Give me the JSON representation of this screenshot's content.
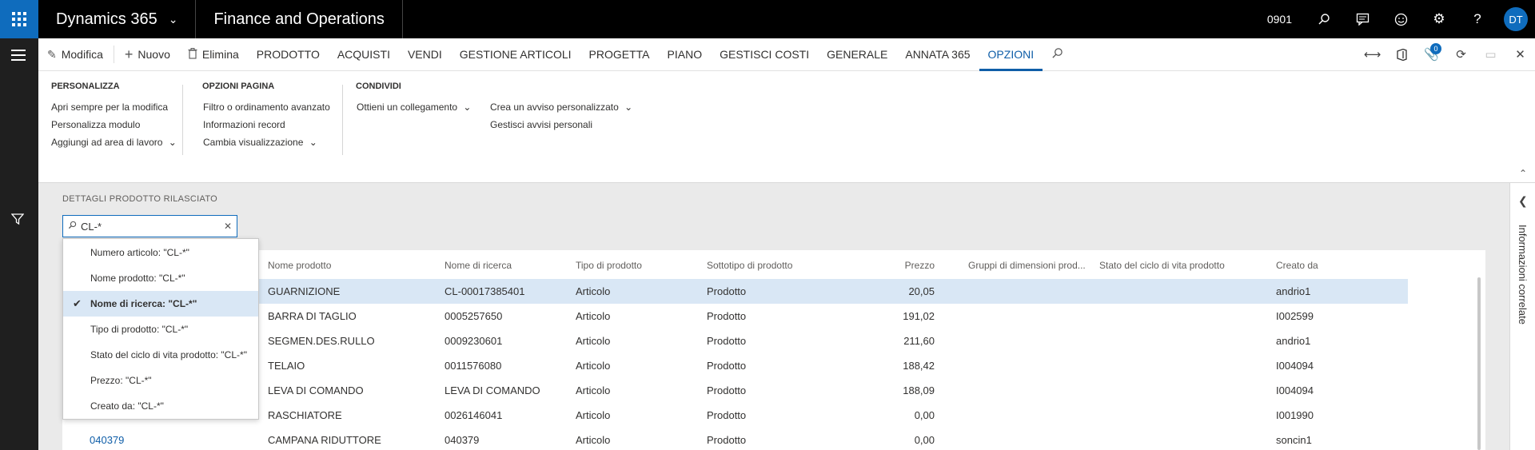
{
  "topbar": {
    "app_name": "Dynamics 365",
    "module_name": "Finance and Operations",
    "company": "0901",
    "user_initials": "DT"
  },
  "actionbar": {
    "edit": "Modifica",
    "new": "Nuovo",
    "delete": "Elimina",
    "tabs": [
      "PRODOTTO",
      "ACQUISTI",
      "VENDI",
      "GESTIONE ARTICOLI",
      "PROGETTA",
      "PIANO",
      "GESTISCI COSTI",
      "GENERALE",
      "ANNATA 365",
      "OPZIONI"
    ],
    "active_tab": "OPZIONI",
    "notification_count": "0"
  },
  "ribbon": {
    "personalizza": {
      "title": "PERSONALIZZA",
      "items": [
        "Apri sempre per la modifica",
        "Personalizza modulo",
        "Aggiungi ad area di lavoro"
      ]
    },
    "opzioni_pagina": {
      "title": "OPZIONI PAGINA",
      "items": [
        "Filtro o ordinamento avanzato",
        "Informazioni record",
        "Cambia visualizzazione"
      ]
    },
    "condividi": {
      "title": "CONDIVIDI",
      "items": [
        "Ottieni un collegamento",
        "Crea un avviso personalizzato",
        "Gestisci avvisi personali"
      ]
    }
  },
  "content": {
    "section_title": "DETTAGLI PRODOTTO RILASCIATO",
    "search_value": "CL-*"
  },
  "dropdown": {
    "items": [
      "Numero articolo: \"CL-*\"",
      "Nome prodotto: \"CL-*\"",
      "Nome di ricerca: \"CL-*\"",
      "Tipo di prodotto: \"CL-*\"",
      "Stato del ciclo di vita prodotto: \"CL-*\"",
      "Prezzo: \"CL-*\"",
      "Creato da: \"CL-*\""
    ],
    "selected_index": 2
  },
  "grid": {
    "columns": [
      "Nome prodotto",
      "Nome di ricerca",
      "Tipo di prodotto",
      "Sottotipo di prodotto",
      "Prezzo",
      "Gruppi di dimensioni prod...",
      "Stato del ciclo di vita prodotto",
      "Creato da"
    ],
    "rows": [
      {
        "item": "",
        "name": "GUARNIZIONE",
        "search": "CL-00017385401",
        "type": "Articolo",
        "subtype": "Prodotto",
        "price": "20,05",
        "created_by": "andrio1"
      },
      {
        "item": "",
        "name": "BARRA DI TAGLIO",
        "search": "0005257650",
        "type": "Articolo",
        "subtype": "Prodotto",
        "price": "191,02",
        "created_by": "I002599"
      },
      {
        "item": "",
        "name": "SEGMEN.DES.RULLO",
        "search": "0009230601",
        "type": "Articolo",
        "subtype": "Prodotto",
        "price": "211,60",
        "created_by": "andrio1"
      },
      {
        "item": "",
        "name": "TELAIO",
        "search": "0011576080",
        "type": "Articolo",
        "subtype": "Prodotto",
        "price": "188,42",
        "created_by": "I004094"
      },
      {
        "item": "",
        "name": "LEVA DI COMANDO",
        "search": "LEVA DI COMANDO",
        "type": "Articolo",
        "subtype": "Prodotto",
        "price": "188,09",
        "created_by": "I004094"
      },
      {
        "item": "",
        "name": "RASCHIATORE",
        "search": "0026146041",
        "type": "Articolo",
        "subtype": "Prodotto",
        "price": "0,00",
        "created_by": "I001990"
      },
      {
        "item": "040379",
        "name": "CAMPANA RIDUTTORE",
        "search": "040379",
        "type": "Articolo",
        "subtype": "Prodotto",
        "price": "0,00",
        "created_by": "soncin1"
      }
    ]
  },
  "sidepanel": {
    "label": "Informazioni correlate"
  }
}
